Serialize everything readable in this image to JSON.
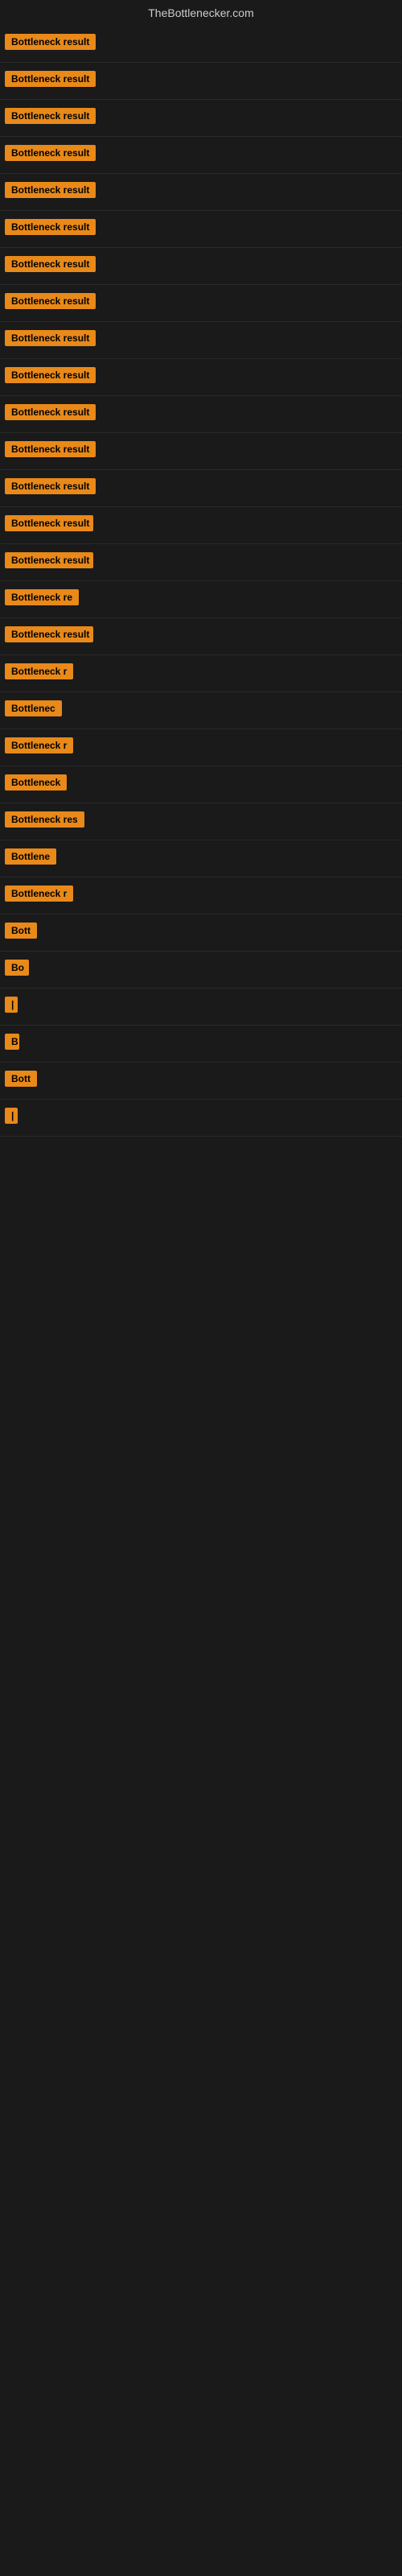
{
  "site": {
    "title": "TheBottlenecker.com"
  },
  "items": [
    {
      "id": 1,
      "label": "Bottleneck result",
      "width": 130
    },
    {
      "id": 2,
      "label": "Bottleneck result",
      "width": 130
    },
    {
      "id": 3,
      "label": "Bottleneck result",
      "width": 130
    },
    {
      "id": 4,
      "label": "Bottleneck result",
      "width": 130
    },
    {
      "id": 5,
      "label": "Bottleneck result",
      "width": 130
    },
    {
      "id": 6,
      "label": "Bottleneck result",
      "width": 130
    },
    {
      "id": 7,
      "label": "Bottleneck result",
      "width": 130
    },
    {
      "id": 8,
      "label": "Bottleneck result",
      "width": 130
    },
    {
      "id": 9,
      "label": "Bottleneck result",
      "width": 130
    },
    {
      "id": 10,
      "label": "Bottleneck result",
      "width": 130
    },
    {
      "id": 11,
      "label": "Bottleneck result",
      "width": 130
    },
    {
      "id": 12,
      "label": "Bottleneck result",
      "width": 120
    },
    {
      "id": 13,
      "label": "Bottleneck result",
      "width": 120
    },
    {
      "id": 14,
      "label": "Bottleneck result",
      "width": 110
    },
    {
      "id": 15,
      "label": "Bottleneck result",
      "width": 110
    },
    {
      "id": 16,
      "label": "Bottleneck re",
      "width": 100
    },
    {
      "id": 17,
      "label": "Bottleneck result",
      "width": 110
    },
    {
      "id": 18,
      "label": "Bottleneck r",
      "width": 90
    },
    {
      "id": 19,
      "label": "Bottlenec",
      "width": 80
    },
    {
      "id": 20,
      "label": "Bottleneck r",
      "width": 90
    },
    {
      "id": 21,
      "label": "Bottleneck",
      "width": 80
    },
    {
      "id": 22,
      "label": "Bottleneck res",
      "width": 100
    },
    {
      "id": 23,
      "label": "Bottlene",
      "width": 70
    },
    {
      "id": 24,
      "label": "Bottleneck r",
      "width": 85
    },
    {
      "id": 25,
      "label": "Bott",
      "width": 45
    },
    {
      "id": 26,
      "label": "Bo",
      "width": 30
    },
    {
      "id": 27,
      "label": "|",
      "width": 10
    },
    {
      "id": 28,
      "label": "B",
      "width": 18
    },
    {
      "id": 29,
      "label": "Bott",
      "width": 45
    },
    {
      "id": 30,
      "label": "|",
      "width": 8
    }
  ]
}
